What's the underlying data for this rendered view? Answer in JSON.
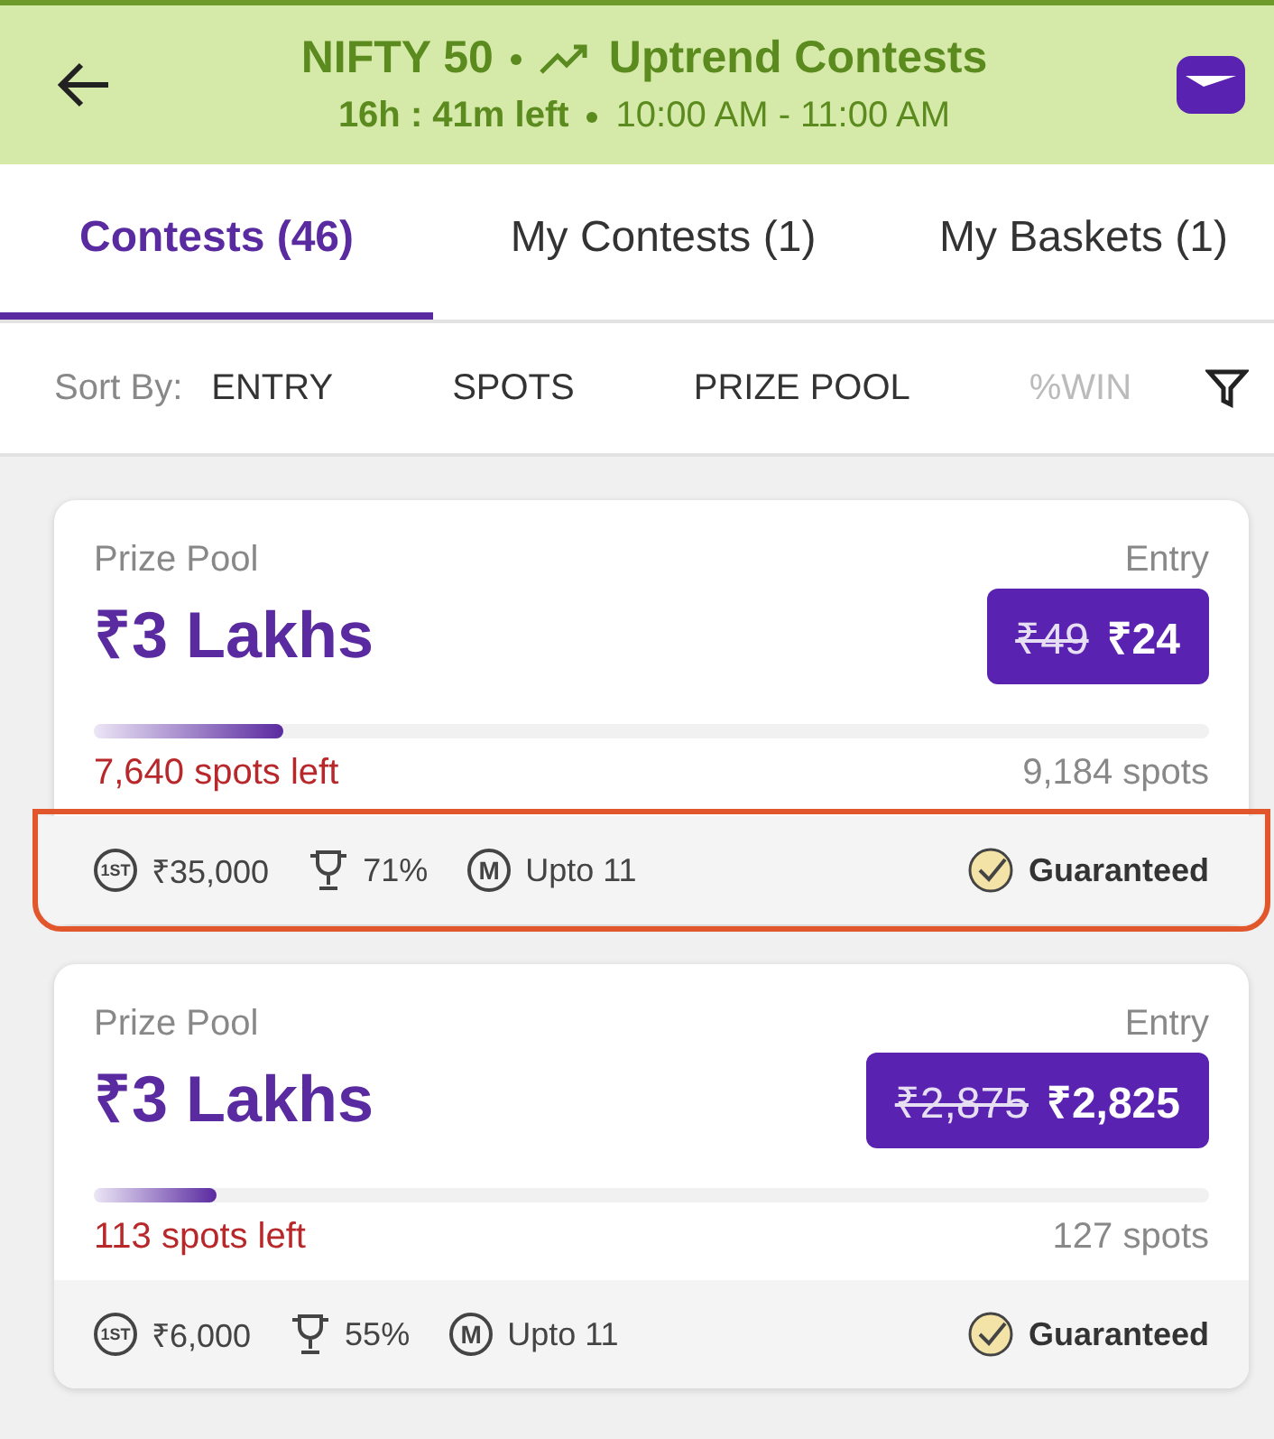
{
  "header": {
    "index": "NIFTY 50",
    "contest_type": "Uptrend Contests",
    "time_left": "16h : 41m left",
    "time_window": "10:00 AM - 11:00 AM"
  },
  "tabs": [
    {
      "label": "Contests (46)",
      "selected": true
    },
    {
      "label": "My Contests (1)",
      "selected": false
    },
    {
      "label": "My Baskets (1)",
      "selected": false
    }
  ],
  "sort_bar": {
    "label": "Sort By:",
    "options": [
      "ENTRY",
      "SPOTS",
      "PRIZE POOL",
      "%WIN"
    ]
  },
  "contests": [
    {
      "prize_pool_label": "Prize Pool",
      "prize_pool": "₹3 Lakhs",
      "entry_label": "Entry",
      "original_fee": "₹49",
      "fee": "₹24",
      "level": 0.17,
      "spots_left": "7,640 spots left",
      "total_spots": "9,184 spots",
      "first_mark": "1ST",
      "first_prize": "₹35,000",
      "win_percent": "71%",
      "multi_mark": "M",
      "max_entries": "Upto 11",
      "guarantee": "Guaranteed",
      "highlighted": true
    },
    {
      "prize_pool_label": "Prize Pool",
      "prize_pool": "₹3 Lakhs",
      "entry_label": "Entry",
      "original_fee": "₹2,875",
      "fee": "₹2,825",
      "level": 0.11,
      "spots_left": "113 spots left",
      "total_spots": "127 spots",
      "first_mark": "1ST",
      "first_prize": "₹6,000",
      "win_percent": "55%",
      "multi_mark": "M",
      "max_entries": "Upto 11",
      "guarantee": "Guaranteed",
      "highlighted": false
    }
  ]
}
